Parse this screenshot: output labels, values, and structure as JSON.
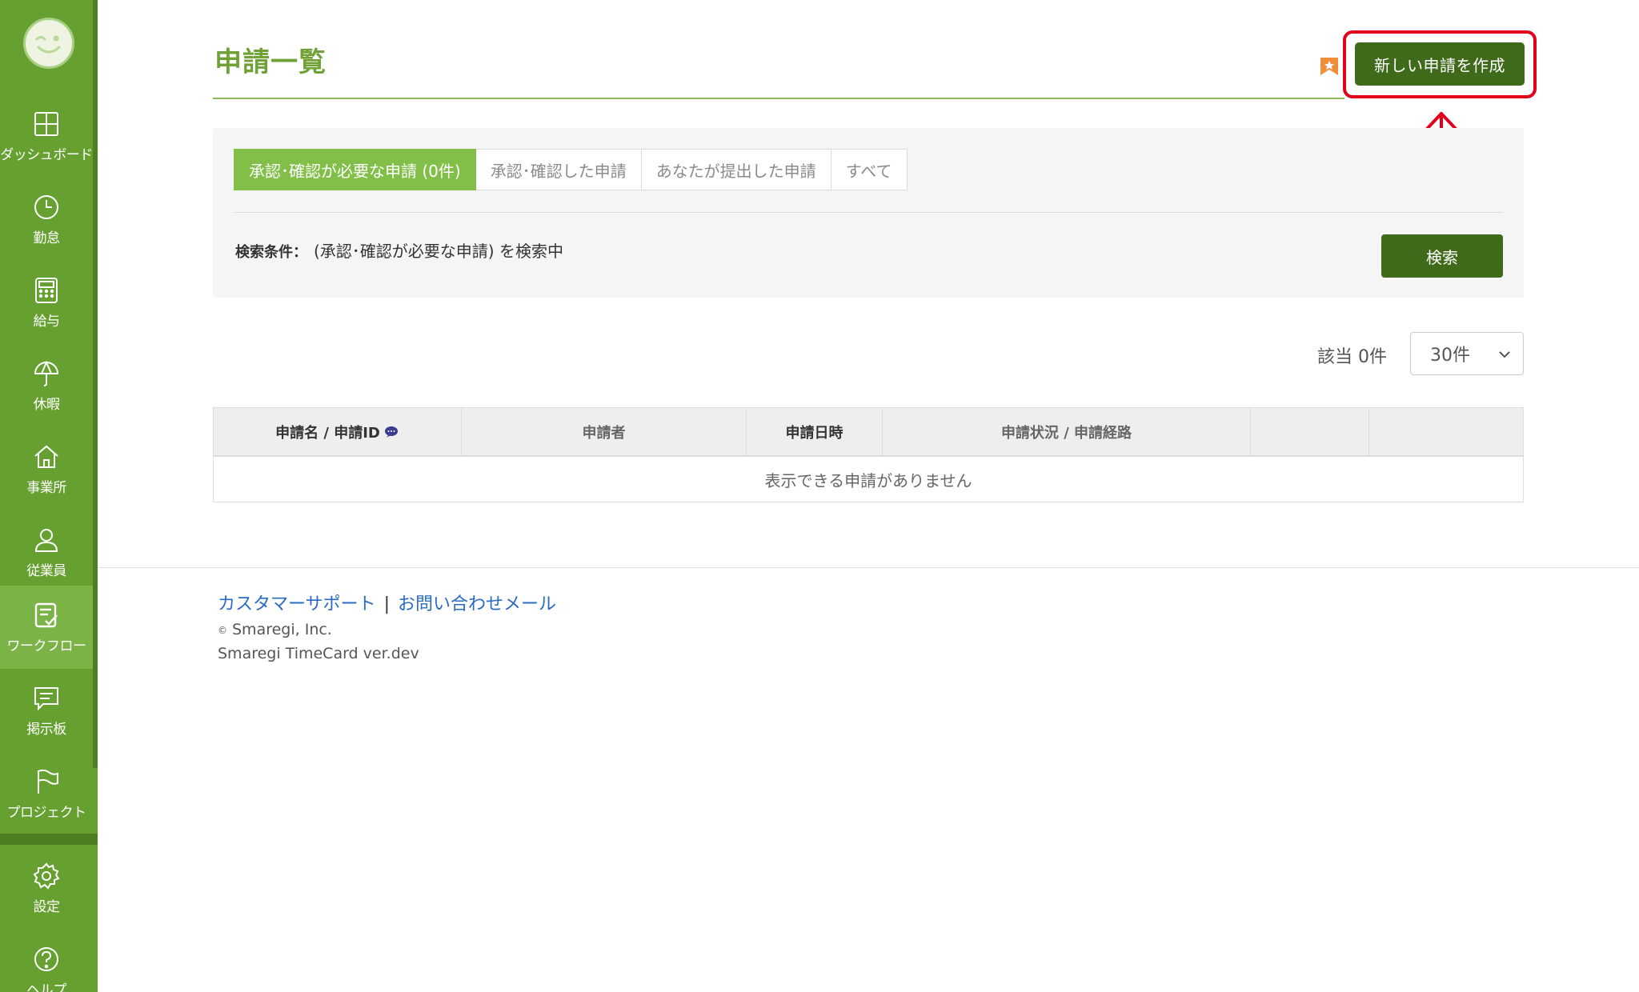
{
  "sidebar": {
    "items": [
      {
        "label": "ダッシュボード",
        "icon": "dashboard-icon"
      },
      {
        "label": "勤怠",
        "icon": "clock-icon"
      },
      {
        "label": "給与",
        "icon": "calculator-icon"
      },
      {
        "label": "休暇",
        "icon": "umbrella-icon"
      },
      {
        "label": "事業所",
        "icon": "home-icon"
      },
      {
        "label": "従業員",
        "icon": "person-icon"
      },
      {
        "label": "ワークフロー",
        "icon": "checklist-icon",
        "active": true
      },
      {
        "label": "掲示板",
        "icon": "chat-icon"
      },
      {
        "label": "プロジェクト",
        "icon": "flag-icon"
      },
      {
        "label": "設定",
        "icon": "gear-icon"
      },
      {
        "label": "ヘルプ",
        "icon": "help-icon"
      }
    ]
  },
  "header": {
    "title": "申請一覧",
    "create_button": "新しい申請を作成"
  },
  "filter": {
    "tabs": [
      {
        "label": "承認･確認が必要な申請 (0件)",
        "active": true
      },
      {
        "label": "承認･確認した申請"
      },
      {
        "label": "あなたが提出した申請"
      },
      {
        "label": "すべて"
      }
    ],
    "condition_label": "検索条件：",
    "condition_value": "(承認･確認が必要な申請) を検索中",
    "search_button": "検索"
  },
  "results": {
    "count_text": "該当 0件",
    "per_page": "30件"
  },
  "table": {
    "columns": [
      "申請名 / 申請ID",
      "申請者",
      "申請日時",
      "申請状況 / 申請経路",
      "",
      ""
    ],
    "empty_message": "表示できる申請がありません"
  },
  "footer": {
    "support_link": "カスタマーサポート",
    "separator": "|",
    "contact_link": "お問い合わせメール",
    "copyright": "Smaregi, Inc.",
    "copyright_mark": "©",
    "version": "Smaregi TimeCard ver.dev"
  },
  "colors": {
    "sidebar": "#66a030",
    "accent": "#6fa136",
    "button": "#3f6a1a",
    "active_tab": "#82bf48",
    "highlight": "#e3001b",
    "link": "#2a6cc4"
  }
}
